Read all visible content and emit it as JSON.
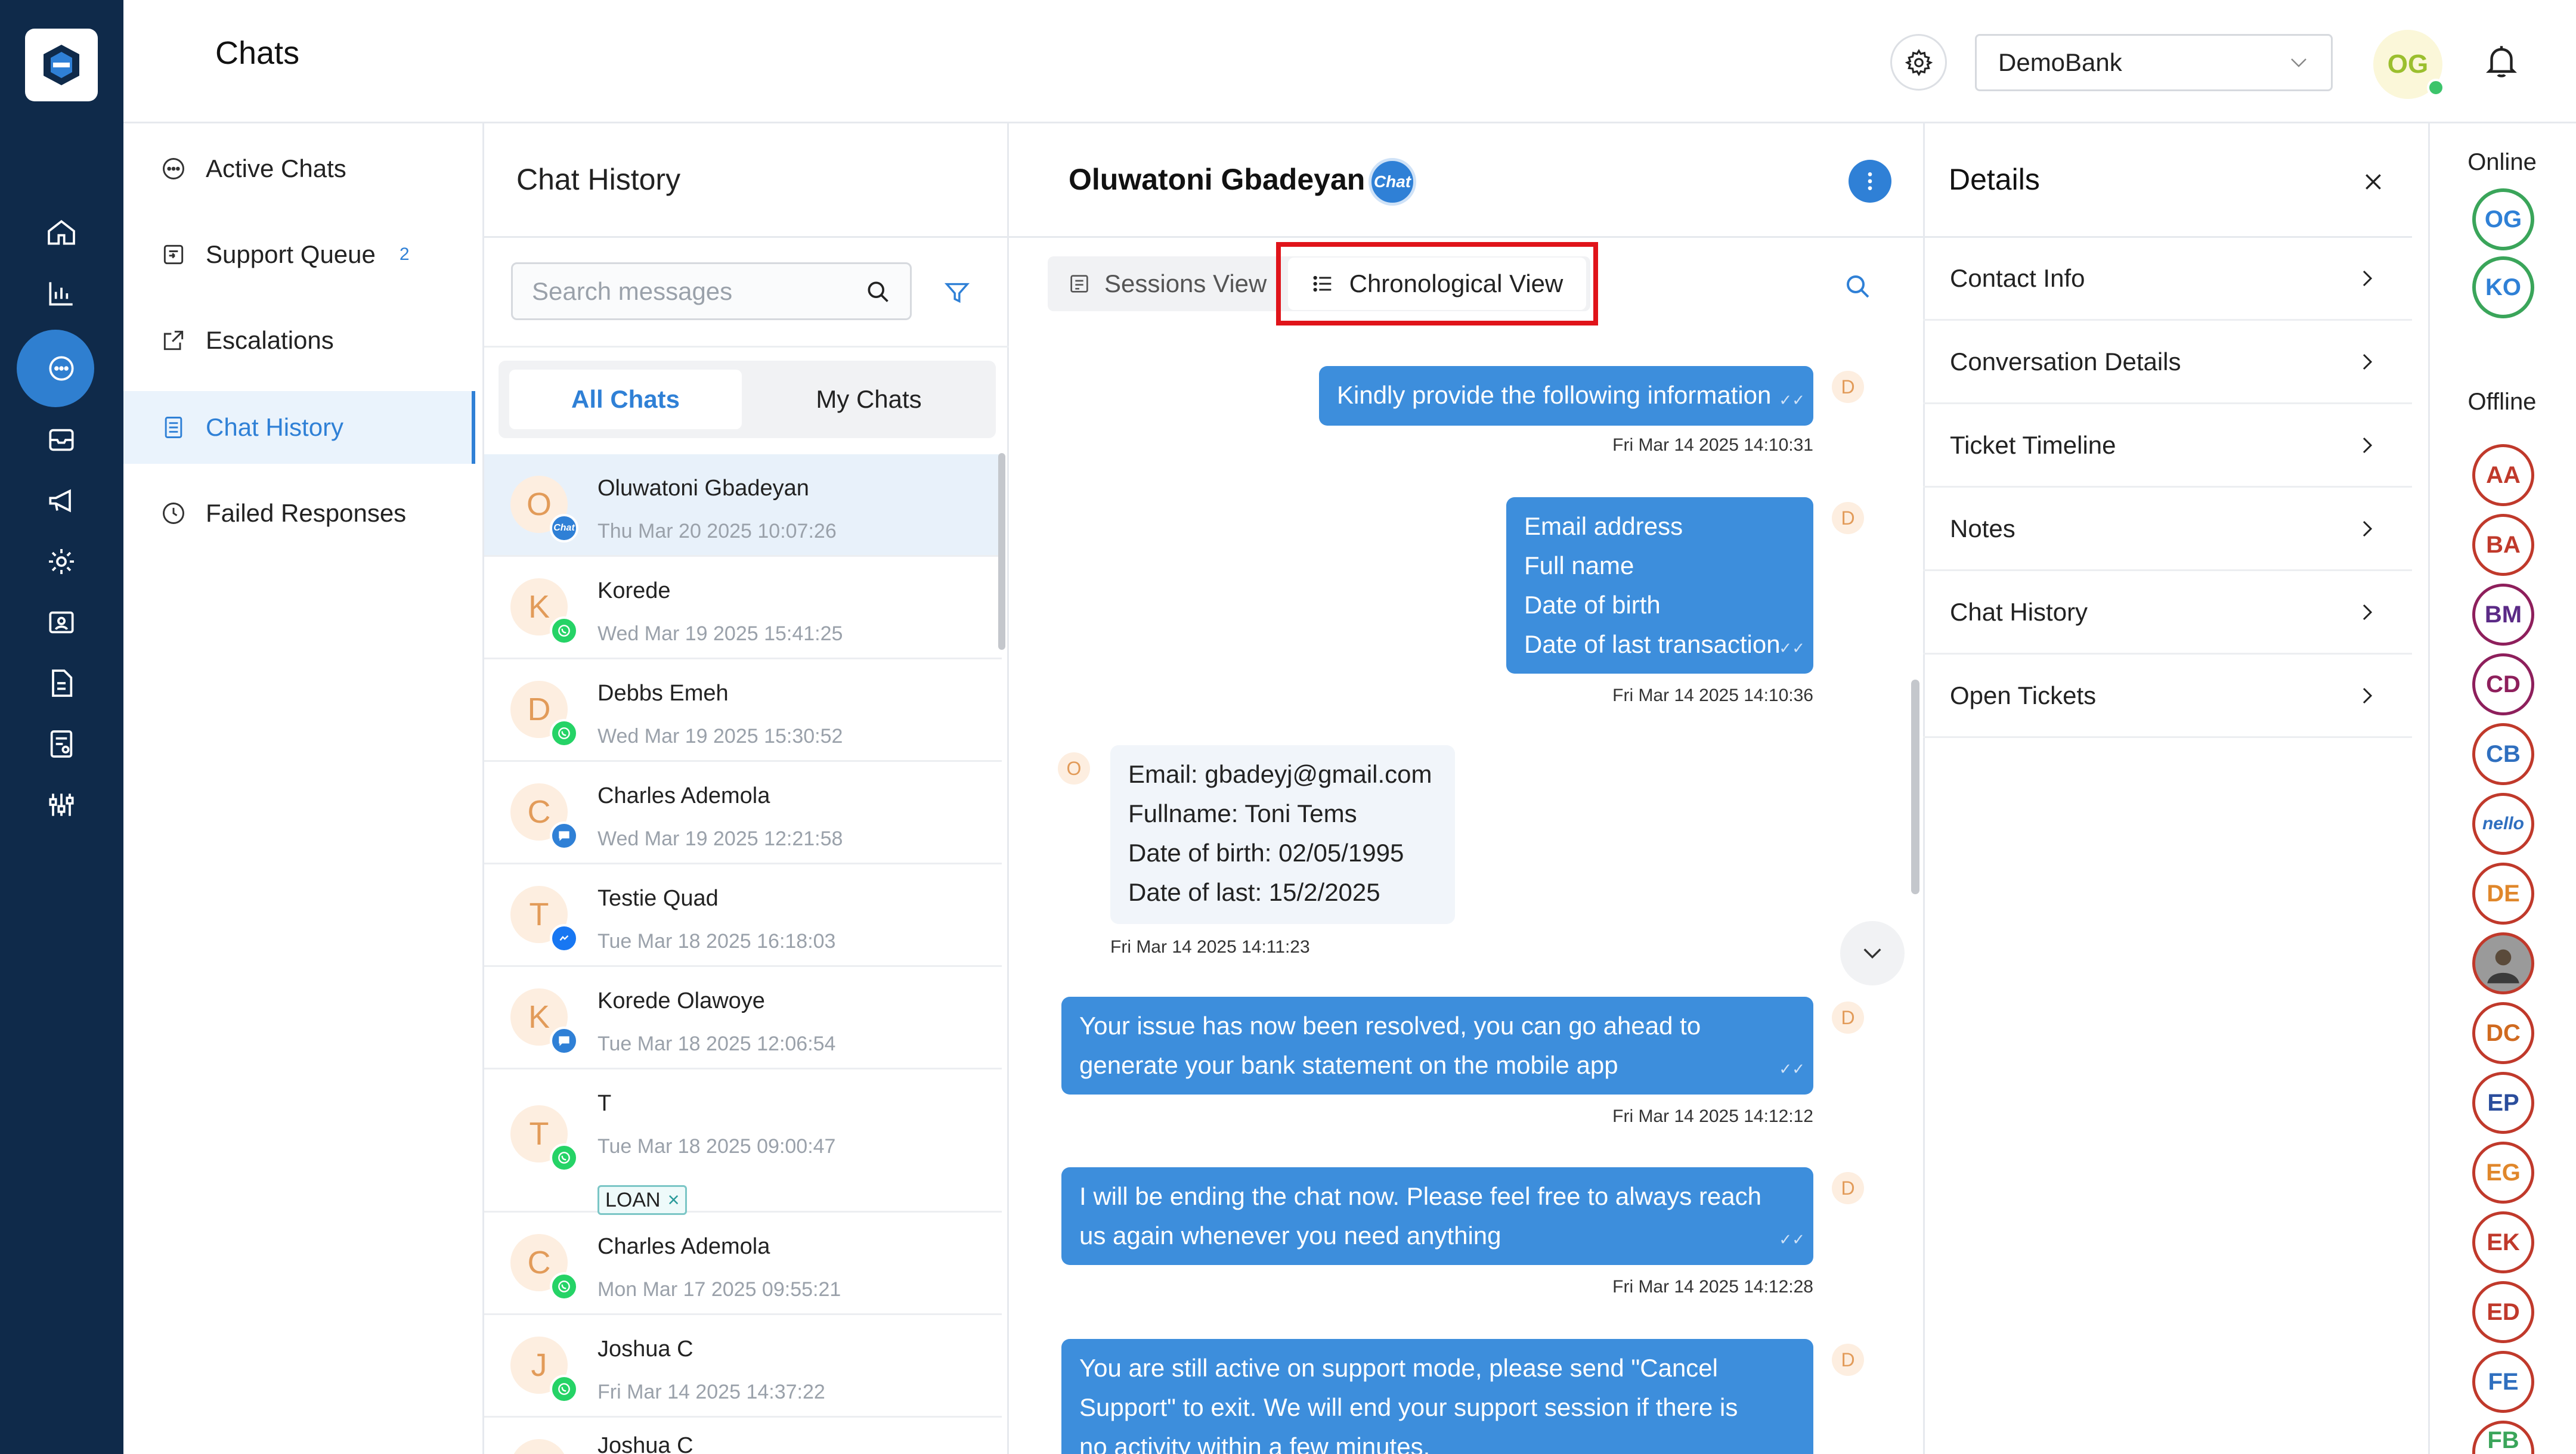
{
  "colors": {
    "rail_bg": "#0f2a4a",
    "accent": "#2f80d6",
    "bubble_out": "#3d8edc",
    "bubble_in": "#f1f5fa",
    "highlight_box": "#e0141a"
  },
  "header": {
    "title": "Chats",
    "bank_select": {
      "value": "DemoBank"
    },
    "user_initials": "OG"
  },
  "rail": {
    "icons": [
      "home-icon",
      "bar-chart-icon",
      "chat-bubble-icon",
      "inbox-icon",
      "megaphone-icon",
      "gear-icon",
      "id-card-icon",
      "document-icon",
      "report-icon",
      "sliders-icon"
    ]
  },
  "nav": {
    "items": [
      {
        "label": "Active Chats",
        "icon": "chat-dots-icon"
      },
      {
        "label": "Support Queue",
        "icon": "queue-icon",
        "badge": "2"
      },
      {
        "label": "Escalations",
        "icon": "external-link-icon"
      },
      {
        "label": "Chat History",
        "icon": "history-list-icon",
        "active": true
      },
      {
        "label": "Failed Responses",
        "icon": "clock-alert-icon"
      }
    ]
  },
  "history": {
    "title": "Chat History",
    "search_placeholder": "Search messages",
    "tabs": {
      "all": "All Chats",
      "my": "My Chats"
    },
    "chats": [
      {
        "initial": "O",
        "name": "Oluwatoni Gbadeyan",
        "time": "Thu Mar 20 2025 10:07:26",
        "channel": "webchat"
      },
      {
        "initial": "K",
        "name": "Korede",
        "time": "Wed Mar 19 2025 15:41:25",
        "channel": "whatsapp"
      },
      {
        "initial": "D",
        "name": "Debbs Emeh",
        "time": "Wed Mar 19 2025 15:30:52",
        "channel": "whatsapp"
      },
      {
        "initial": "C",
        "name": "Charles Ademola",
        "time": "Wed Mar 19 2025 12:21:58",
        "channel": "message"
      },
      {
        "initial": "T",
        "name": "Testie Quad",
        "time": "Tue Mar 18 2025 16:18:03",
        "channel": "messenger"
      },
      {
        "initial": "K",
        "name": "Korede Olawoye",
        "time": "Tue Mar 18 2025 12:06:54",
        "channel": "message"
      },
      {
        "initial": "T",
        "name": "T",
        "time": "Tue Mar 18 2025 09:00:47",
        "channel": "whatsapp",
        "tag": "LOAN"
      },
      {
        "initial": "C",
        "name": "Charles Ademola",
        "time": "Mon Mar 17 2025 09:55:21",
        "channel": "whatsapp"
      },
      {
        "initial": "J",
        "name": "Joshua C",
        "time": "Fri Mar 14 2025 14:37:22",
        "channel": "whatsapp"
      },
      {
        "initial": "J",
        "name": "Joshua C",
        "time": "",
        "channel": "whatsapp"
      }
    ]
  },
  "conversation": {
    "contact_name": "Oluwatoni Gbadeyan",
    "channel_badge": "Chat",
    "view_tabs": {
      "sessions": "Sessions View",
      "chronological": "Chronological View"
    },
    "messages": [
      {
        "dir": "out",
        "avatar": "D",
        "lines": [
          "Kindly provide the following information"
        ],
        "time": "Fri Mar 14 2025 14:10:31"
      },
      {
        "dir": "out",
        "avatar": "D",
        "lines": [
          "Email address",
          "Full name",
          "Date of birth",
          "Date of last transaction"
        ],
        "time": "Fri Mar 14 2025 14:10:36"
      },
      {
        "dir": "in",
        "avatar": "O",
        "lines": [
          "Email: gbadeyj@gmail.com",
          "Fullname: Toni Tems",
          "Date of birth: 02/05/1995",
          "Date of last: 15/2/2025"
        ],
        "time": "Fri Mar 14 2025 14:11:23"
      },
      {
        "dir": "out",
        "avatar": "D",
        "lines": [
          "Your issue has now been resolved, you can go ahead to",
          "generate your bank statement on the mobile app"
        ],
        "time": "Fri Mar 14 2025 14:12:12"
      },
      {
        "dir": "out",
        "avatar": "D",
        "lines": [
          "I will be ending the chat now. Please feel free to always reach",
          "us again whenever you need anything"
        ],
        "time": "Fri Mar 14 2025 14:12:28"
      },
      {
        "dir": "out",
        "avatar": "D",
        "lines": [
          "You are still active on support mode, please send \"Cancel",
          "Support\" to exit. We will end your support session if there is",
          "no activity within a few minutes."
        ],
        "time": ""
      }
    ]
  },
  "details": {
    "title": "Details",
    "rows": [
      "Contact Info",
      "Conversation Details",
      "Ticket Timeline",
      "Notes",
      "Chat History",
      "Open Tickets"
    ]
  },
  "presence": {
    "online_label": "Online",
    "offline_label": "Offline",
    "online": [
      {
        "initials": "OG",
        "color": "#3aa55a"
      },
      {
        "initials": "KO",
        "color": "#3aa55a"
      }
    ],
    "offline": [
      {
        "initials": "AA",
        "color": "#c0392b"
      },
      {
        "initials": "BA",
        "color": "#c0392b"
      },
      {
        "initials": "BM",
        "color": "#5b2a86"
      },
      {
        "initials": "CD",
        "color": "#8e1f5c"
      },
      {
        "initials": "CB",
        "color": "#2f6fbf"
      },
      {
        "initials": "nello",
        "color": "#2f6fbf"
      },
      {
        "initials": "DE",
        "color": "#e0872b"
      },
      {
        "initials": "",
        "color": "#8a8a8a"
      },
      {
        "initials": "DC",
        "color": "#d06a1f"
      },
      {
        "initials": "EP",
        "color": "#2a4d9c"
      },
      {
        "initials": "EG",
        "color": "#e0872b"
      },
      {
        "initials": "EK",
        "color": "#c0392b"
      },
      {
        "initials": "ED",
        "color": "#c0392b"
      },
      {
        "initials": "FE",
        "color": "#2f6fbf"
      },
      {
        "initials": "FB",
        "color": "#3aa55a"
      }
    ]
  }
}
